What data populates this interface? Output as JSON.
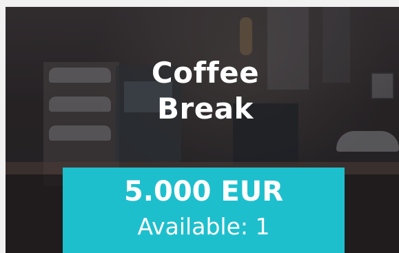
{
  "card": {
    "title_line1": "Coffee",
    "title_line2": "Break",
    "price": "5.000 EUR",
    "availability": "Available: 1",
    "background_image": "coffee-station-photo",
    "accent_color": "#1ebfcd"
  }
}
